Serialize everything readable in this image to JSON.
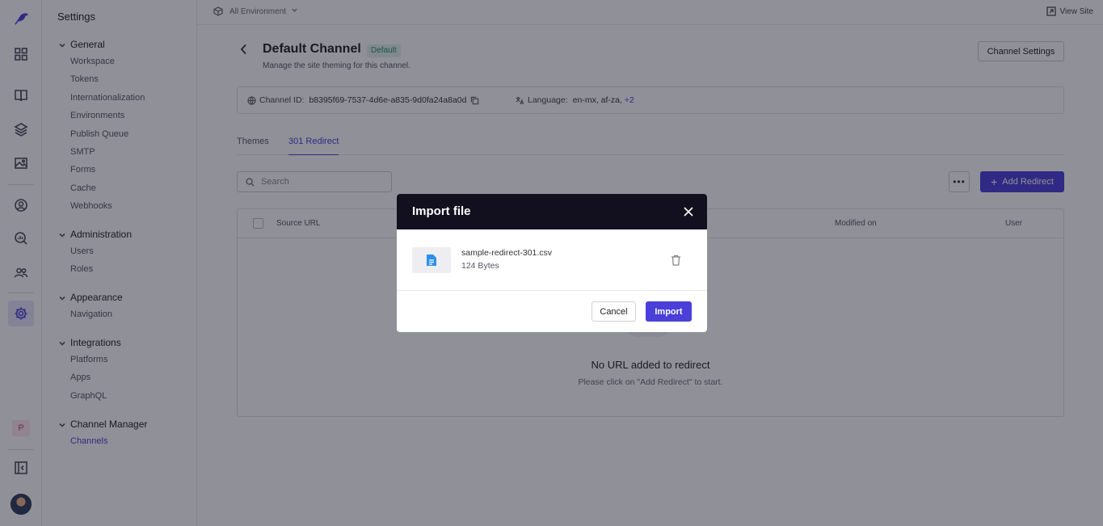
{
  "settings": {
    "title": "Settings",
    "groups": [
      {
        "label": "General",
        "items": [
          "Workspace",
          "Tokens",
          "Internationalization",
          "Environments",
          "Publish Queue",
          "SMTP",
          "Forms",
          "Cache",
          "Webhooks"
        ]
      },
      {
        "label": "Administration",
        "items": [
          "Users",
          "Roles"
        ]
      },
      {
        "label": "Appearance",
        "items": [
          "Navigation"
        ]
      },
      {
        "label": "Integrations",
        "items": [
          "Platforms",
          "Apps",
          "GraphQL"
        ]
      },
      {
        "label": "Channel Manager",
        "items": [
          "Channels"
        ]
      }
    ],
    "active_item": "Channels"
  },
  "rail": {
    "icons": [
      "logo-icon",
      "dashboard-icon",
      "book-icon",
      "layers-icon",
      "image-icon",
      "user-circle-icon",
      "search-analytics-icon",
      "team-icon",
      "settings-gear-icon",
      "collapse-sidebar-icon"
    ],
    "project_initial": "P"
  },
  "topbar": {
    "environment": "All Environment",
    "view_site": "View Site"
  },
  "header": {
    "title": "Default Channel",
    "badge": "Default",
    "subtitle": "Manage the site theming for this channel.",
    "settings_button": "Channel Settings"
  },
  "info": {
    "channel_id_label": "Channel ID:",
    "channel_id": "b8395f69-7537-4d6e-a835-9d0fa24a8a0d",
    "language_label": "Language:",
    "languages": "en-mx, af-za,",
    "languages_more": "+2"
  },
  "tabs": [
    {
      "label": "Themes",
      "active": false
    },
    {
      "label": "301 Redirect",
      "active": true
    }
  ],
  "toolbar": {
    "search_placeholder": "Search",
    "more_label": "•••",
    "add_label": "Add Redirect"
  },
  "table": {
    "columns": [
      "Source URL",
      "Modified on",
      "User"
    ],
    "empty_title": "No URL added to redirect",
    "empty_subtitle": "Please click on \"Add Redirect\" to start."
  },
  "modal": {
    "title": "Import file",
    "file_name": "sample-redirect-301.csv",
    "file_size": "124 Bytes",
    "cancel_label": "Cancel",
    "import_label": "Import"
  },
  "colors": {
    "accent": "#4a3fd9",
    "modal_header": "#12101f",
    "badge_bg": "#e1f3ec",
    "badge_text": "#2f8a60"
  }
}
